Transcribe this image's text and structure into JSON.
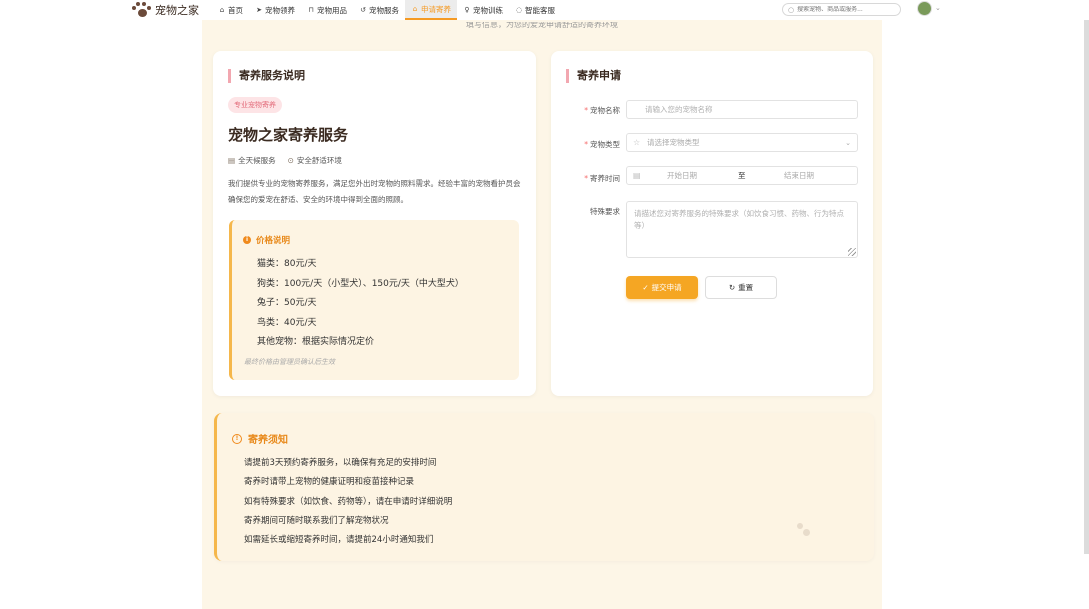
{
  "nav": {
    "brand": "宠物之家",
    "items": [
      {
        "label": "首页",
        "icon": "home-icon",
        "glyph": "⌂"
      },
      {
        "label": "宠物领养",
        "icon": "send-icon",
        "glyph": "➤"
      },
      {
        "label": "宠物用品",
        "icon": "bag-icon",
        "glyph": "⊓"
      },
      {
        "label": "宠物服务",
        "icon": "service-icon",
        "glyph": "↺"
      },
      {
        "label": "申请寄养",
        "icon": "house-icon",
        "glyph": "⌂"
      },
      {
        "label": "宠物训练",
        "icon": "trophy-icon",
        "glyph": "♀"
      },
      {
        "label": "智能客服",
        "icon": "chat-icon",
        "glyph": "◌"
      }
    ],
    "active_index": 4,
    "search_placeholder": "搜索宠物、商品或服务..."
  },
  "intro_text": "填写信息，为您的爱宠申请舒适的寄养环境",
  "service": {
    "section_title": "寄养服务说明",
    "tag": "专业宠物寄养",
    "heading": "宠物之家寄养服务",
    "meta": [
      "全天候服务",
      "安全舒适环境"
    ],
    "description": "我们提供专业的宠物寄养服务，满足您外出时宠物的照料需求。经验丰富的宠物看护员会确保您的爱宠在舒适、安全的环境中得到全面的照顾。",
    "price": {
      "title": "价格说明",
      "items": [
        "猫类：80元/天",
        "狗类：100元/天（小型犬）、150元/天（中大型犬）",
        "兔子：50元/天",
        "鸟类：40元/天",
        "其他宠物：根据实际情况定价"
      ],
      "note": "最终价格由管理员确认后生效"
    }
  },
  "form": {
    "section_title": "寄养申请",
    "name_label": "宠物名称",
    "name_placeholder": "请输入您的宠物名称",
    "type_label": "宠物类型",
    "type_placeholder": "请选择宠物类型",
    "time_label": "寄养时间",
    "start_placeholder": "开始日期",
    "range_sep": "至",
    "end_placeholder": "结束日期",
    "special_label": "特殊要求",
    "special_placeholder": "请描述您对寄养服务的特殊要求（如饮食习惯、药物、行为特点等）",
    "submit_label": "提交申请",
    "reset_label": "重置"
  },
  "notice": {
    "title": "寄养须知",
    "items": [
      "请提前3天预约寄养服务，以确保有充足的安排时间",
      "寄养时请带上宠物的健康证明和疫苗接种记录",
      "如有特殊要求（如饮食、药物等），请在申请时详细说明",
      "寄养期间可随时联系我们了解宠物状况",
      "如需延长或缩短寄养时间，请提前24小时通知我们"
    ]
  },
  "colors": {
    "accent": "#f5a623",
    "page_bg": "#fdf6e7",
    "title_bar": "#f2a7b0"
  }
}
